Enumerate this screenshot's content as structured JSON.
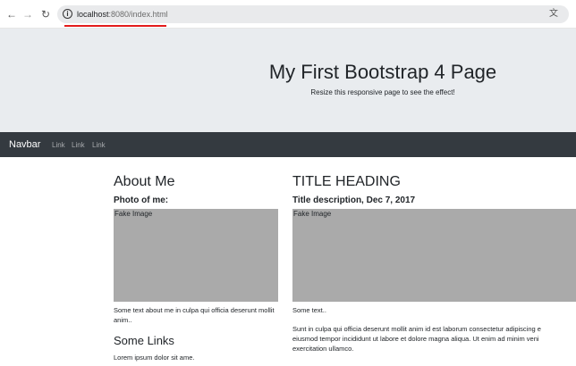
{
  "browser": {
    "back_icon": "arrow-left-icon",
    "forward_icon": "arrow-right-icon",
    "reload_icon": "reload-icon",
    "url_host": "localhost",
    "url_rest": ":8080/index.html",
    "annotation_color": "#e31b1b"
  },
  "jumbotron": {
    "title": "My First Bootstrap 4 Page",
    "subtitle": "Resize this responsive page to see the effect!"
  },
  "navbar": {
    "brand": "Navbar",
    "links": [
      "Link",
      "Link",
      "Link"
    ]
  },
  "about": {
    "title": "About Me",
    "photo_label": "Photo of me:",
    "image_label": "Fake Image",
    "text": "Some text about me in culpa qui officia deserunt mollit anim..",
    "links_title": "Some Links",
    "links_text": "Lorem ipsum dolor sit ame."
  },
  "post": {
    "title": "TITLE HEADING",
    "description": "Title description, Dec 7, 2017",
    "image_label": "Fake Image",
    "short_text": "Some text..",
    "body_lines": [
      "Sunt in culpa qui officia deserunt mollit anim id est laborum consectetur adipiscing e",
      "eiusmod tempor incididunt ut labore et dolore magna aliqua. Ut enim ad minim veni",
      "exercitation ullamco."
    ]
  }
}
